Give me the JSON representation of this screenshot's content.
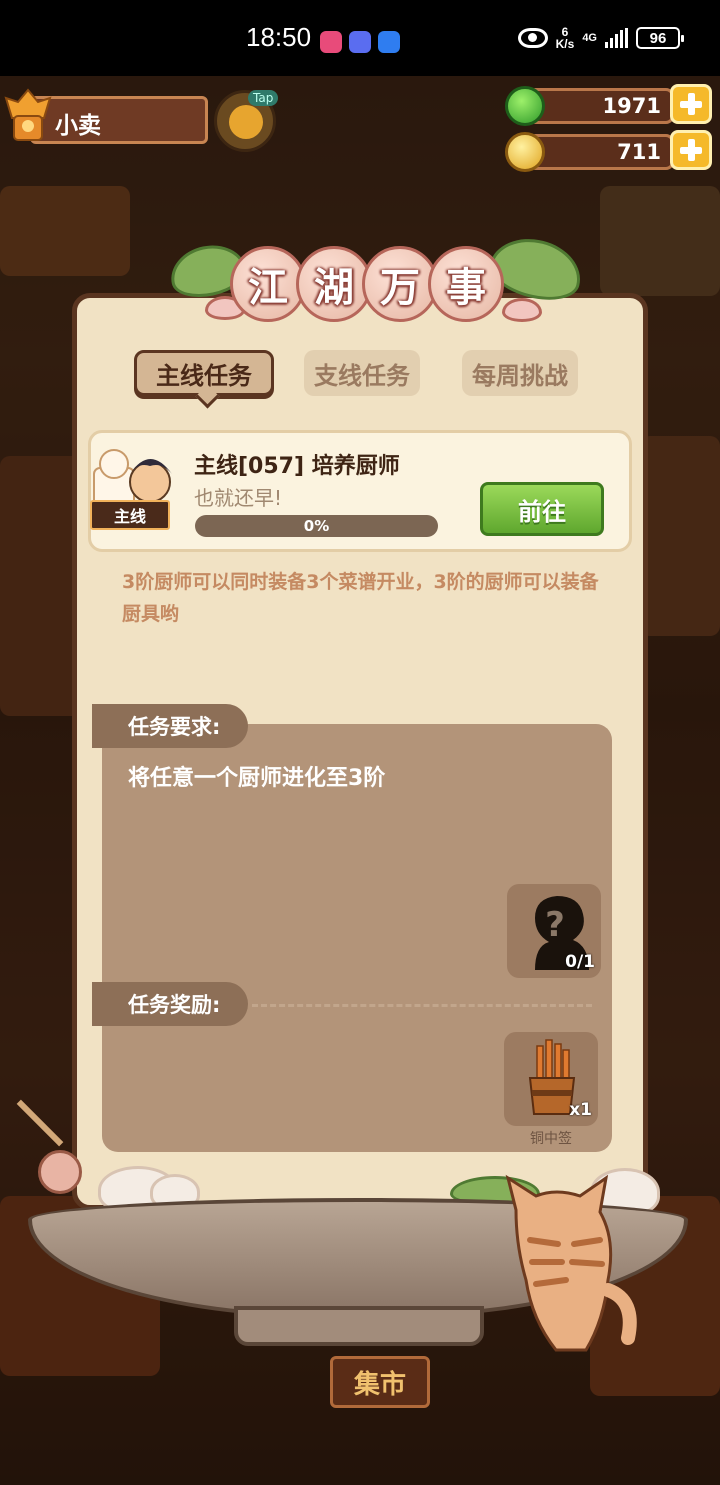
{
  "status_bar": {
    "time": "18:50",
    "speed_value": "6",
    "speed_unit": "K/s",
    "network": "4G",
    "battery": "96"
  },
  "player": {
    "name": "小卖",
    "tap_label": "Tap"
  },
  "currencies": {
    "jade": "1971",
    "coins": "711"
  },
  "panel": {
    "title_chars": [
      "江",
      "湖",
      "万",
      "事"
    ],
    "tabs": [
      "主线任务",
      "支线任务",
      "每周挑战"
    ],
    "active_tab": "主线任务"
  },
  "quest": {
    "tag": "主线",
    "title": "主线[057] 培养厨师",
    "subtitle": "也就还早!",
    "progress_fraction": 0,
    "progress_text": "0%",
    "go_label": "前往",
    "description": "3阶厨师可以同时装备3个菜谱开业，3阶的厨师可以装备厨具哟"
  },
  "requirement": {
    "label": "任务要求:",
    "text": "将任意一个厨师进化至3阶",
    "slot_icon": "unknown-chef-silhouette-icon",
    "slot_count": "0/1"
  },
  "reward": {
    "label": "任务奖励:",
    "item_icon": "copper-lot-sticks-icon",
    "item_count": "x1",
    "item_name": "铜中签"
  },
  "background": {
    "market_sign": "集市"
  },
  "colors": {
    "panel": "#f1e2c4",
    "panel_border": "#5a3520",
    "go_button": "#6fb73a",
    "description": "#c58a62"
  }
}
